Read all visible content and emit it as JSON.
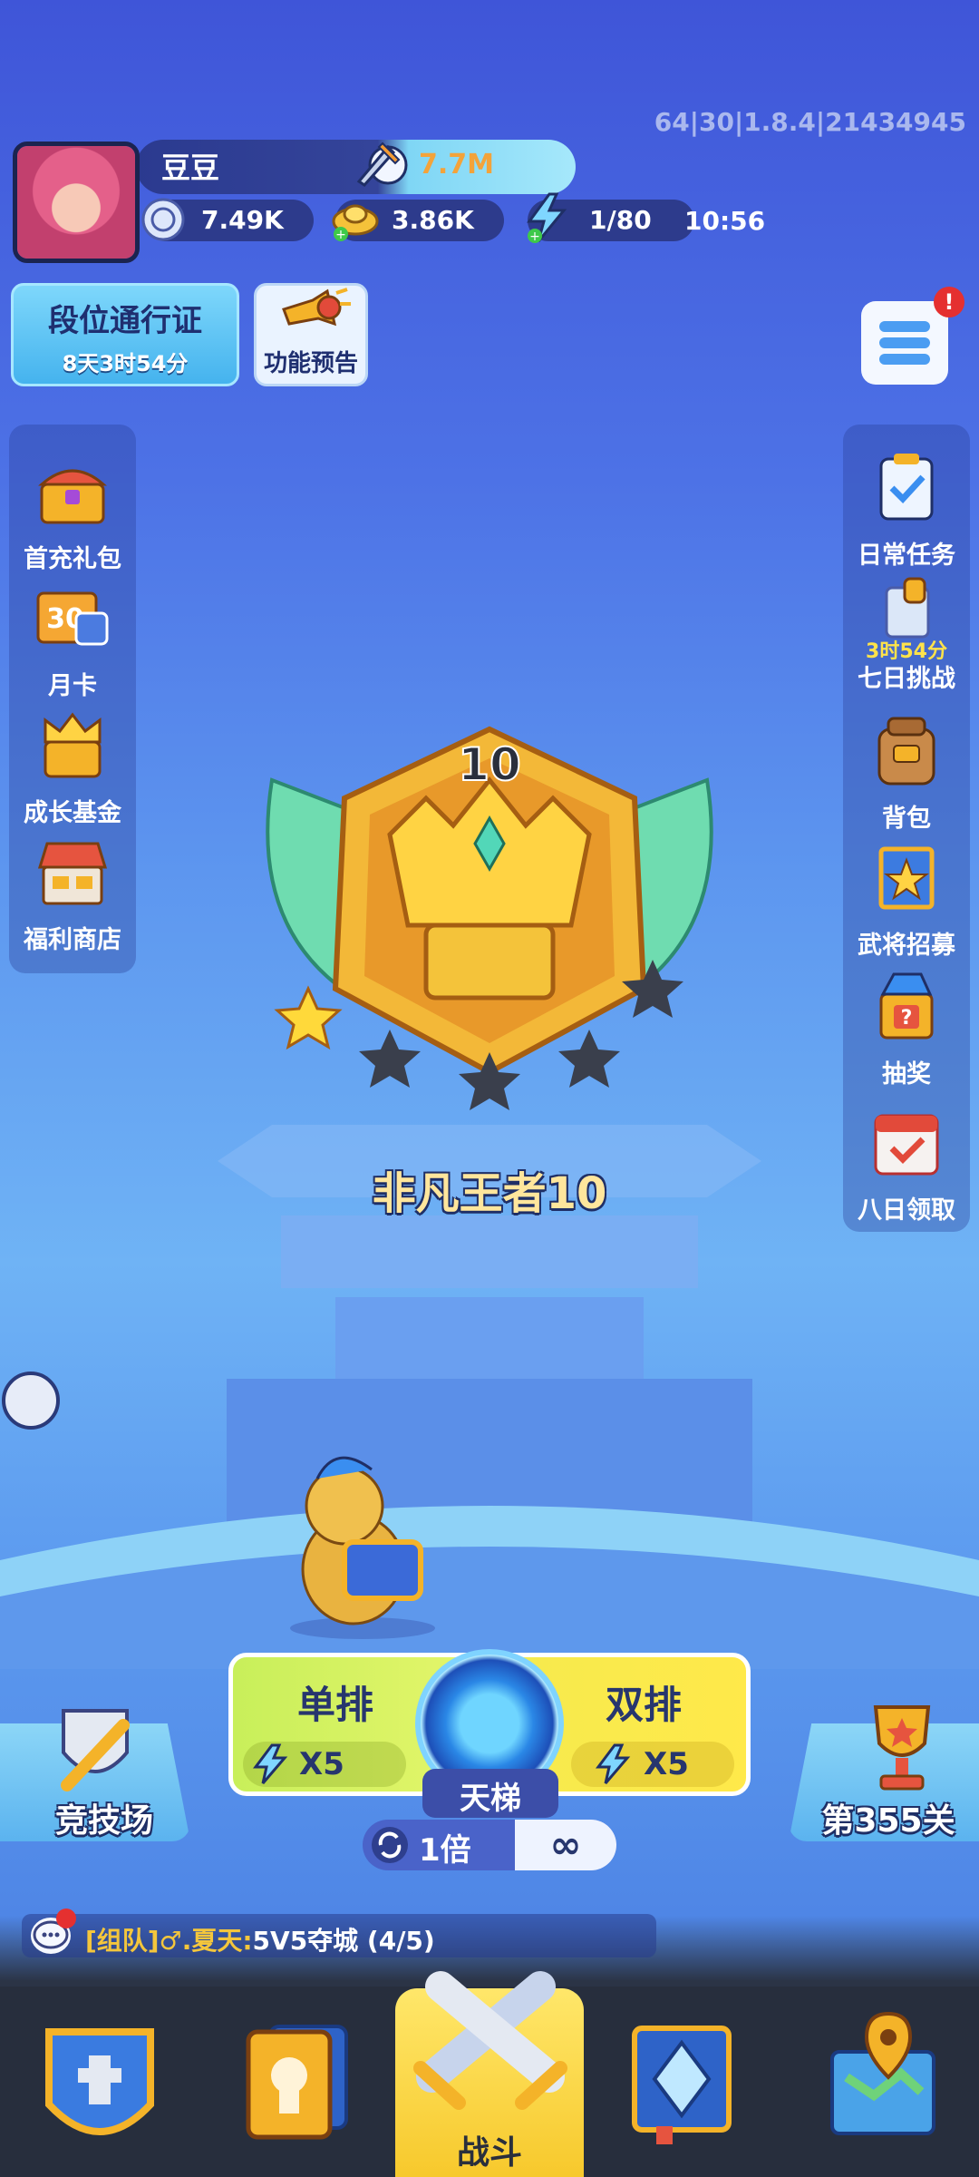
{
  "version": "64|30|1.8.4|21434945",
  "player": {
    "name": "豆豆",
    "power": "7.7M"
  },
  "resources": [
    {
      "icon": "silver-coin-icon",
      "value": "7.49K"
    },
    {
      "icon": "gold-ingot-icon",
      "value": "3.86K"
    },
    {
      "icon": "energy-icon",
      "value": "1/80"
    }
  ],
  "clock": "10:56",
  "pass": {
    "title": "段位通行证",
    "timer": "8天3时54分"
  },
  "preview": {
    "label": "功能预告"
  },
  "menu": {
    "badge": "!"
  },
  "left_menu": [
    {
      "label": "首充礼包",
      "icon": "treasure-chest-icon"
    },
    {
      "label": "月卡",
      "icon": "monthly-card-icon",
      "badge": "30"
    },
    {
      "label": "成长基金",
      "icon": "crown-chest-icon"
    },
    {
      "label": "福利商店",
      "icon": "shop-icon"
    }
  ],
  "right_menu": [
    {
      "label": "日常任务",
      "icon": "clipboard-icon"
    },
    {
      "label": "七日挑战",
      "icon": "scroll-icon",
      "timer": "3时54分"
    },
    {
      "label": "背包",
      "icon": "backpack-icon"
    },
    {
      "label": "武将招募",
      "icon": "recruit-scroll-icon"
    },
    {
      "label": "抽奖",
      "icon": "lottery-box-icon"
    },
    {
      "label": "八日领取",
      "icon": "calendar-icon"
    }
  ],
  "rank": {
    "level": "10",
    "name": "非凡王者10",
    "stars_filled": 1,
    "stars_total": 5
  },
  "battle": {
    "solo": {
      "label": "单排",
      "cost": "X5"
    },
    "duo": {
      "label": "双排",
      "cost": "X5"
    },
    "ladder_label": "天梯",
    "multiplier": "1倍",
    "infinity": "∞"
  },
  "arena": {
    "label": "竞技场"
  },
  "level": {
    "label": "第355关"
  },
  "chat": {
    "channel": "[组队]",
    "sender": "♂.夏天:",
    "message": "5V5夺城 (4/5)"
  },
  "nav": {
    "battle_label": "战斗"
  },
  "colors": {
    "accent_yellow": "#ffe76a",
    "panel_blue": "#2d3b8c",
    "badge_red": "#e53030"
  }
}
